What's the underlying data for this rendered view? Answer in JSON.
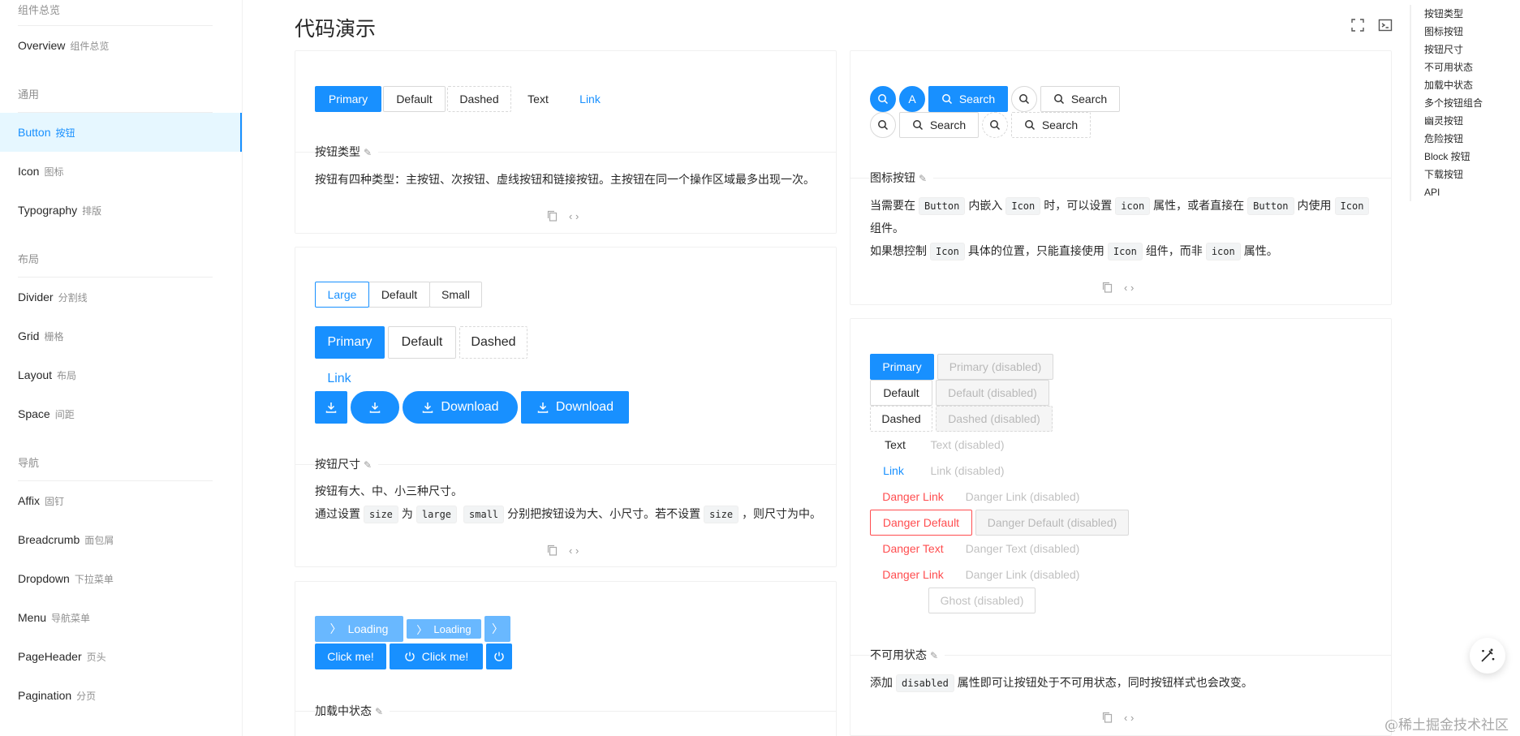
{
  "sidebar": {
    "top_group": "组件总览",
    "overview": {
      "en": "Overview",
      "cn": "组件总览"
    },
    "groups": {
      "general": "通用",
      "layout": "布局",
      "nav": "导航"
    },
    "general_items": [
      {
        "en": "Button",
        "cn": "按钮"
      },
      {
        "en": "Icon",
        "cn": "图标"
      },
      {
        "en": "Typography",
        "cn": "排版"
      }
    ],
    "layout_items": [
      {
        "en": "Divider",
        "cn": "分割线"
      },
      {
        "en": "Grid",
        "cn": "栅格"
      },
      {
        "en": "Layout",
        "cn": "布局"
      },
      {
        "en": "Space",
        "cn": "间距"
      }
    ],
    "nav_items": [
      {
        "en": "Affix",
        "cn": "固钉"
      },
      {
        "en": "Breadcrumb",
        "cn": "面包屑"
      },
      {
        "en": "Dropdown",
        "cn": "下拉菜单"
      },
      {
        "en": "Menu",
        "cn": "导航菜单"
      },
      {
        "en": "PageHeader",
        "cn": "页头"
      },
      {
        "en": "Pagination",
        "cn": "分页"
      }
    ]
  },
  "page": {
    "title": "代码演示"
  },
  "type_demo": {
    "buttons": [
      "Primary",
      "Default",
      "Dashed",
      "Text",
      "Link"
    ],
    "title": "按钮类型",
    "desc": "按钮有四种类型：主按钮、次按钮、虚线按钮和链接按钮。主按钮在同一个操作区域最多出现一次。"
  },
  "size_demo": {
    "radios": [
      "Large",
      "Default",
      "Small"
    ],
    "buttons": [
      "Primary",
      "Default",
      "Dashed"
    ],
    "link": "Link",
    "download": "Download",
    "title": "按钮尺寸",
    "desc1": "按钮有大、中、小三种尺寸。",
    "desc2": {
      "a": "通过设置",
      "code_size": "size",
      "b": "为",
      "code_large": "large",
      "code_small": "small",
      "c": "分别把按钮设为大、小尺寸。若不设置",
      "code_size2": "size",
      "d": "，则尺寸为中。"
    }
  },
  "loading_demo": {
    "loading": "Loading",
    "click": "Click me!",
    "title": "加载中状态"
  },
  "icon_demo": {
    "a_letter": "A",
    "search": "Search",
    "title": "图标按钮",
    "desc1": {
      "a": "当需要在",
      "code_button": "Button",
      "b": "内嵌入",
      "code_icon": "Icon",
      "c": "时，可以设置",
      "code_icon_attr": "icon",
      "d": "属性，或者直接在",
      "code_button2": "Button",
      "e": "内使用",
      "code_icon2": "Icon",
      "f": "组件。"
    },
    "desc2": {
      "a": "如果想控制",
      "code_icon": "Icon",
      "b": "具体的位置，只能直接使用",
      "code_icon2": "Icon",
      "c": "组件，而非",
      "code_icon_attr": "icon",
      "d": "属性。"
    }
  },
  "disabled_demo": {
    "primary": "Primary",
    "primary_d": "Primary (disabled)",
    "default": "Default",
    "default_d": "Default (disabled)",
    "dashed": "Dashed",
    "dashed_d": "Dashed (disabled)",
    "text": "Text",
    "text_d": "Text (disabled)",
    "link": "Link",
    "link_d": "Link (disabled)",
    "danger_link": "Danger Link",
    "danger_link_d": "Danger Link (disabled)",
    "danger_default": "Danger Default",
    "danger_default_d": "Danger Default (disabled)",
    "danger_text": "Danger Text",
    "danger_text_d": "Danger Text (disabled)",
    "ghost_d": "Ghost (disabled)",
    "title": "不可用状态",
    "desc": {
      "a": "添加",
      "code": "disabled",
      "b": "属性即可让按钮处于不可用状态，同时按钮样式也会改变。"
    }
  },
  "anchor": [
    "按钮类型",
    "图标按钮",
    "按钮尺寸",
    "不可用状态",
    "加载中状态",
    "多个按钮组合",
    "幽灵按钮",
    "危险按钮",
    "Block 按钮",
    "下载按钮",
    "API"
  ],
  "watermark": "@稀土掘金技术社区",
  "colors": {
    "primary": "#1890ff",
    "danger": "#ff4d4f",
    "active_bg": "#e6f7ff"
  }
}
